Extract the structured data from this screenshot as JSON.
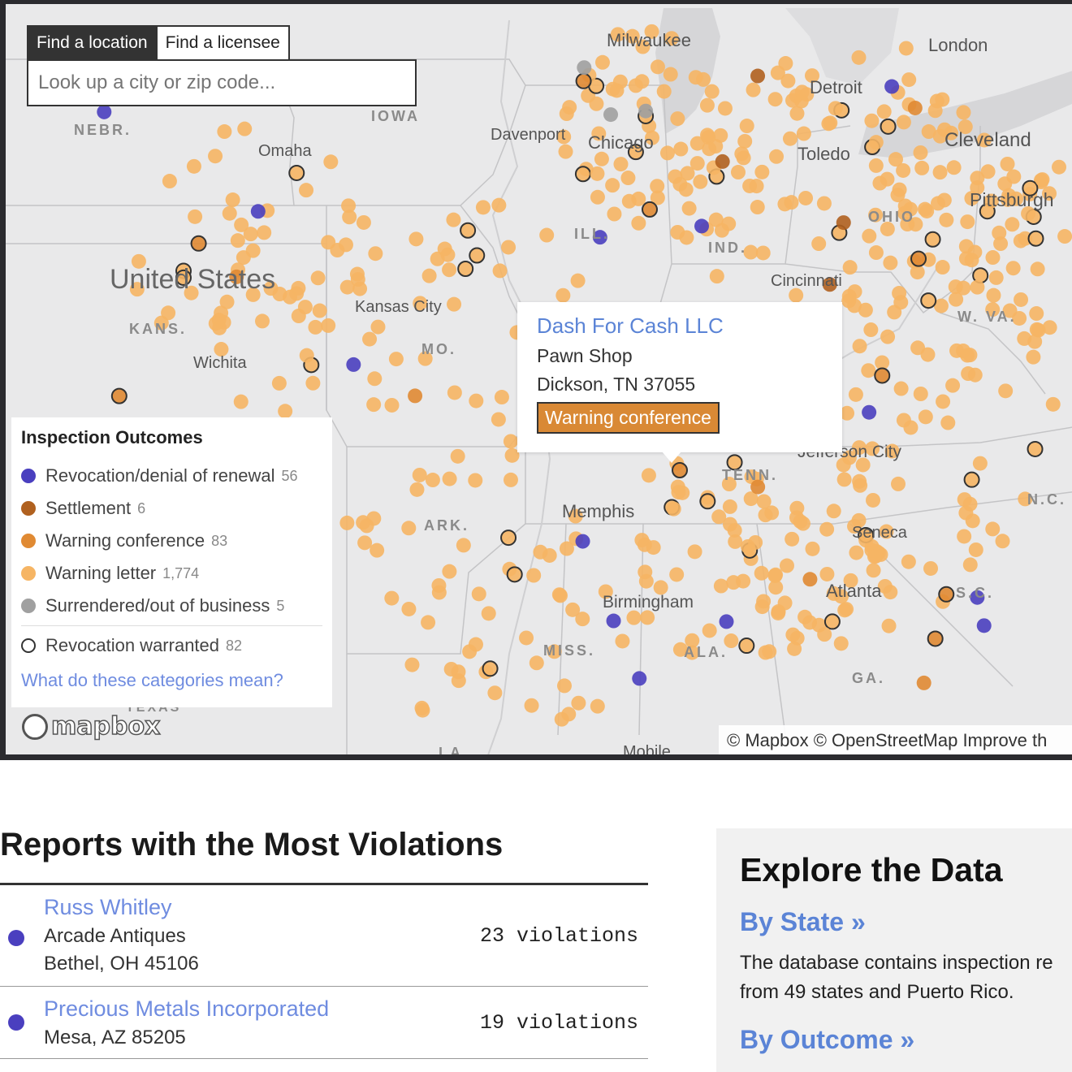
{
  "search": {
    "tabs": [
      "Find a location",
      "Find a licensee"
    ],
    "placeholder": "Look up a city or zip code..."
  },
  "map_labels": {
    "cities": [
      "Milwaukee",
      "London",
      "Detroit",
      "Davenport",
      "Chicago",
      "Omaha",
      "Toledo",
      "Cleveland",
      "Pittsburgh",
      "Kansas City",
      "Wichita",
      "Cincinnati",
      "Jefferson City",
      "Memphis",
      "Seneca",
      "Atlanta",
      "Birmingham",
      "Mobile"
    ],
    "states": [
      "NEBR.",
      "IOWA",
      "ILL.",
      "IND.",
      "OHIO",
      "KANS.",
      "MO.",
      "W. VA.",
      "TENN.",
      "ARK.",
      "S.C.",
      "MISS.",
      "ALA.",
      "GA.",
      "LA.",
      "TEXAS",
      "N.C."
    ],
    "country": "United States"
  },
  "colors": {
    "revocation": "#4a3fbf",
    "settlement": "#b0611f",
    "warning_conference": "#e08a33",
    "warning_letter": "#f6b564",
    "surrendered": "#a0a0a0"
  },
  "legend": {
    "title": "Inspection Outcomes",
    "items": [
      {
        "label": "Revocation/denial of renewal",
        "count": "56",
        "color": "#4a3fbf"
      },
      {
        "label": "Settlement",
        "count": "6",
        "color": "#b0611f"
      },
      {
        "label": "Warning conference",
        "count": "83",
        "color": "#e08a33"
      },
      {
        "label": "Warning letter",
        "count": "1,774",
        "color": "#f6b564"
      },
      {
        "label": "Surrendered/out of business",
        "count": "5",
        "color": "#a0a0a0"
      }
    ],
    "warranted": {
      "label": "Revocation warranted",
      "count": "82"
    },
    "link": "What do these categories mean?"
  },
  "popup": {
    "name": "Dash For Cash LLC",
    "type": "Pawn Shop",
    "location": "Dickson, TN 37055",
    "outcome": "Warning conference"
  },
  "attribution": {
    "logo": "mapbox",
    "text": "© Mapbox © OpenStreetMap Improve th"
  },
  "reports": {
    "title": "Reports with the Most Violations",
    "rows": [
      {
        "name": "Russ Whitley",
        "business": "Arcade Antiques",
        "location": "Bethel, OH 45106",
        "violations": "23 violations"
      },
      {
        "name": "Precious Metals Incorporated",
        "business": "",
        "location": "Mesa, AZ 85205",
        "violations": "19 violations"
      }
    ]
  },
  "explore": {
    "title": "Explore the Data",
    "by_state": "By State »",
    "by_state_desc": "The database contains inspection re from 49 states and Puerto Rico.",
    "by_outcome": "By Outcome »"
  }
}
